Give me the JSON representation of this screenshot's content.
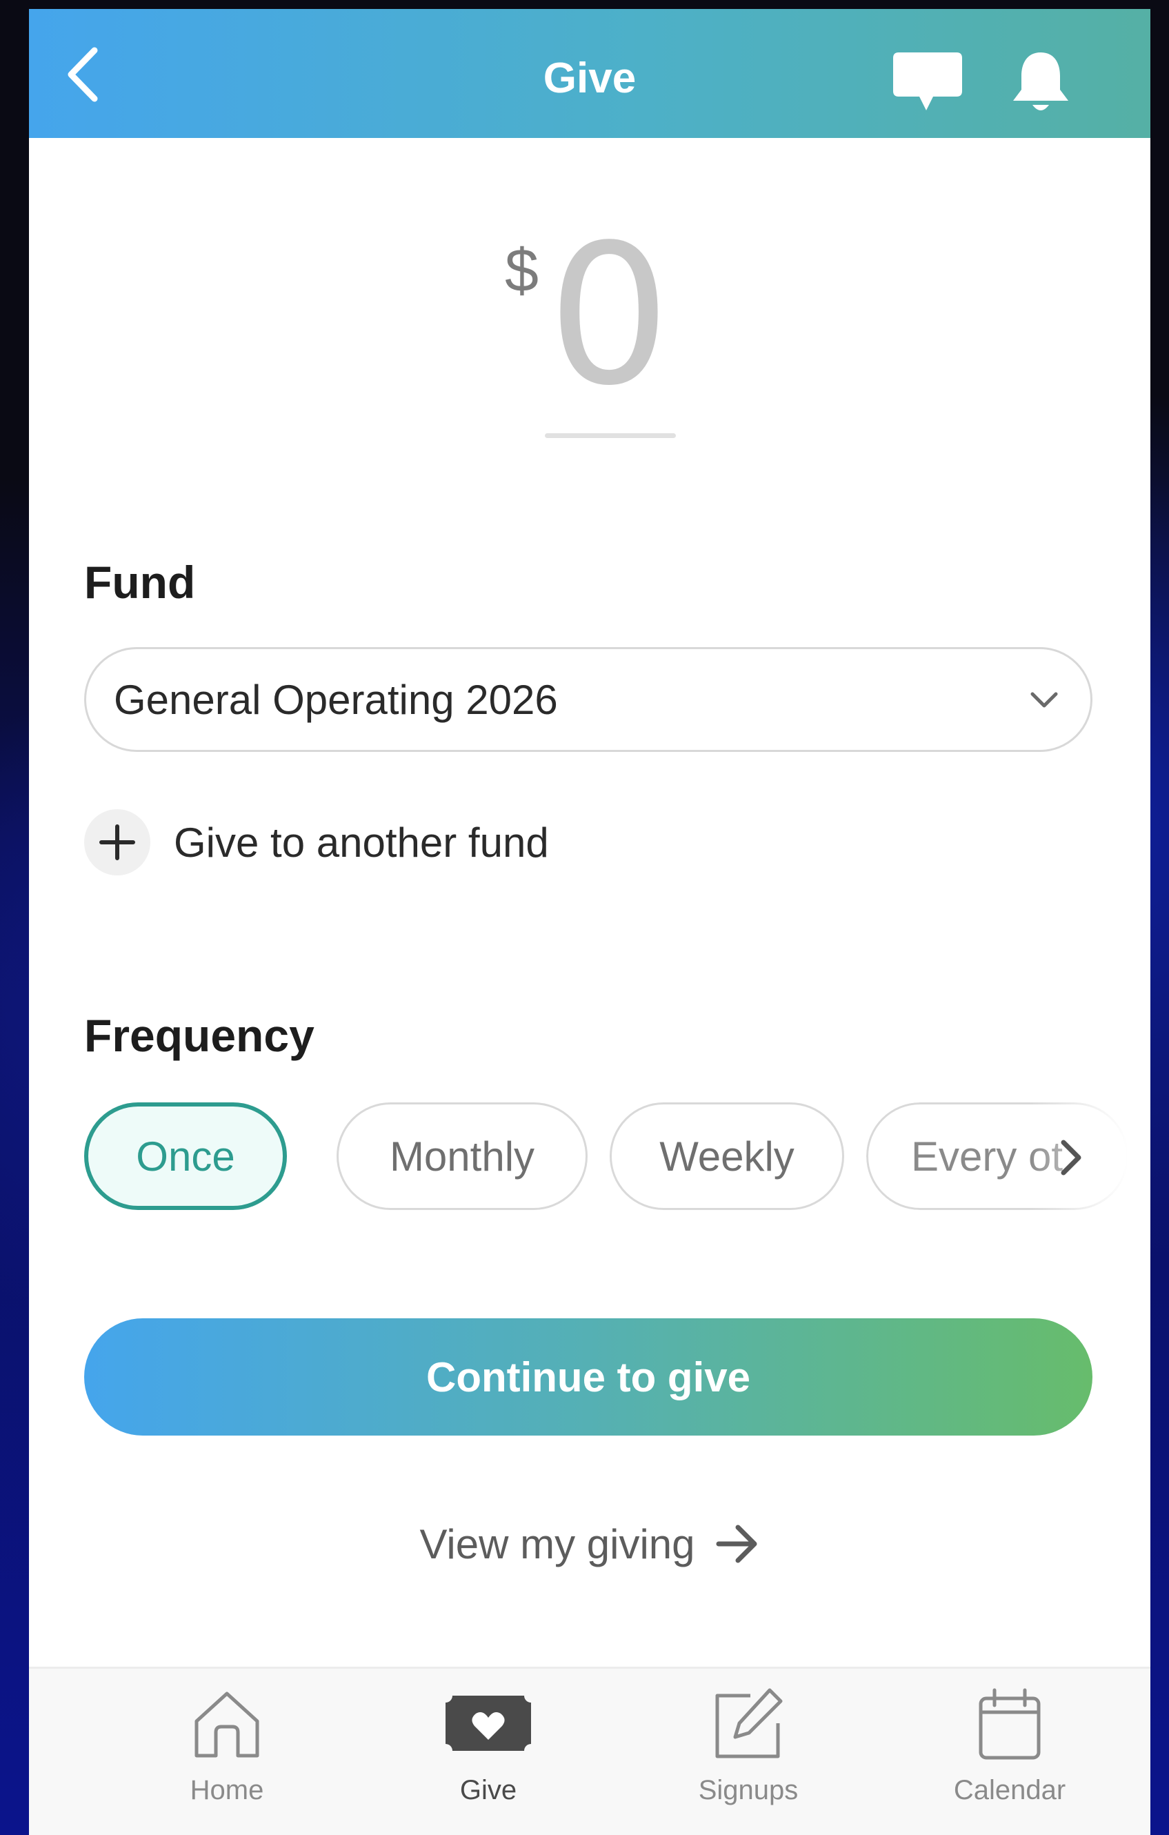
{
  "header": {
    "title": "Give",
    "back_icon": "chevron-left-icon",
    "chat_icon": "chat-bubble-icon",
    "bell_icon": "bell-icon"
  },
  "amount": {
    "currency_symbol": "$",
    "value": "0"
  },
  "fund": {
    "label": "Fund",
    "selected": "General Operating 2026",
    "add_label": "Give to another fund"
  },
  "frequency": {
    "label": "Frequency",
    "options": [
      "Once",
      "Monthly",
      "Weekly",
      "Every ot"
    ],
    "selected": "Once"
  },
  "actions": {
    "continue_label": "Continue to give",
    "view_giving_label": "View my giving"
  },
  "tabs": [
    {
      "label": "Home",
      "icon": "home-icon",
      "active": false
    },
    {
      "label": "Give",
      "icon": "give-icon",
      "active": true
    },
    {
      "label": "Signups",
      "icon": "signups-icon",
      "active": false
    },
    {
      "label": "Calendar",
      "icon": "calendar-icon",
      "active": false
    }
  ],
  "colors": {
    "header_gradient_start": "#45a5ec",
    "header_gradient_end": "#55b0a5",
    "selected_chip": "#2d9c8f",
    "button_gradient_end": "#67bc6c"
  }
}
